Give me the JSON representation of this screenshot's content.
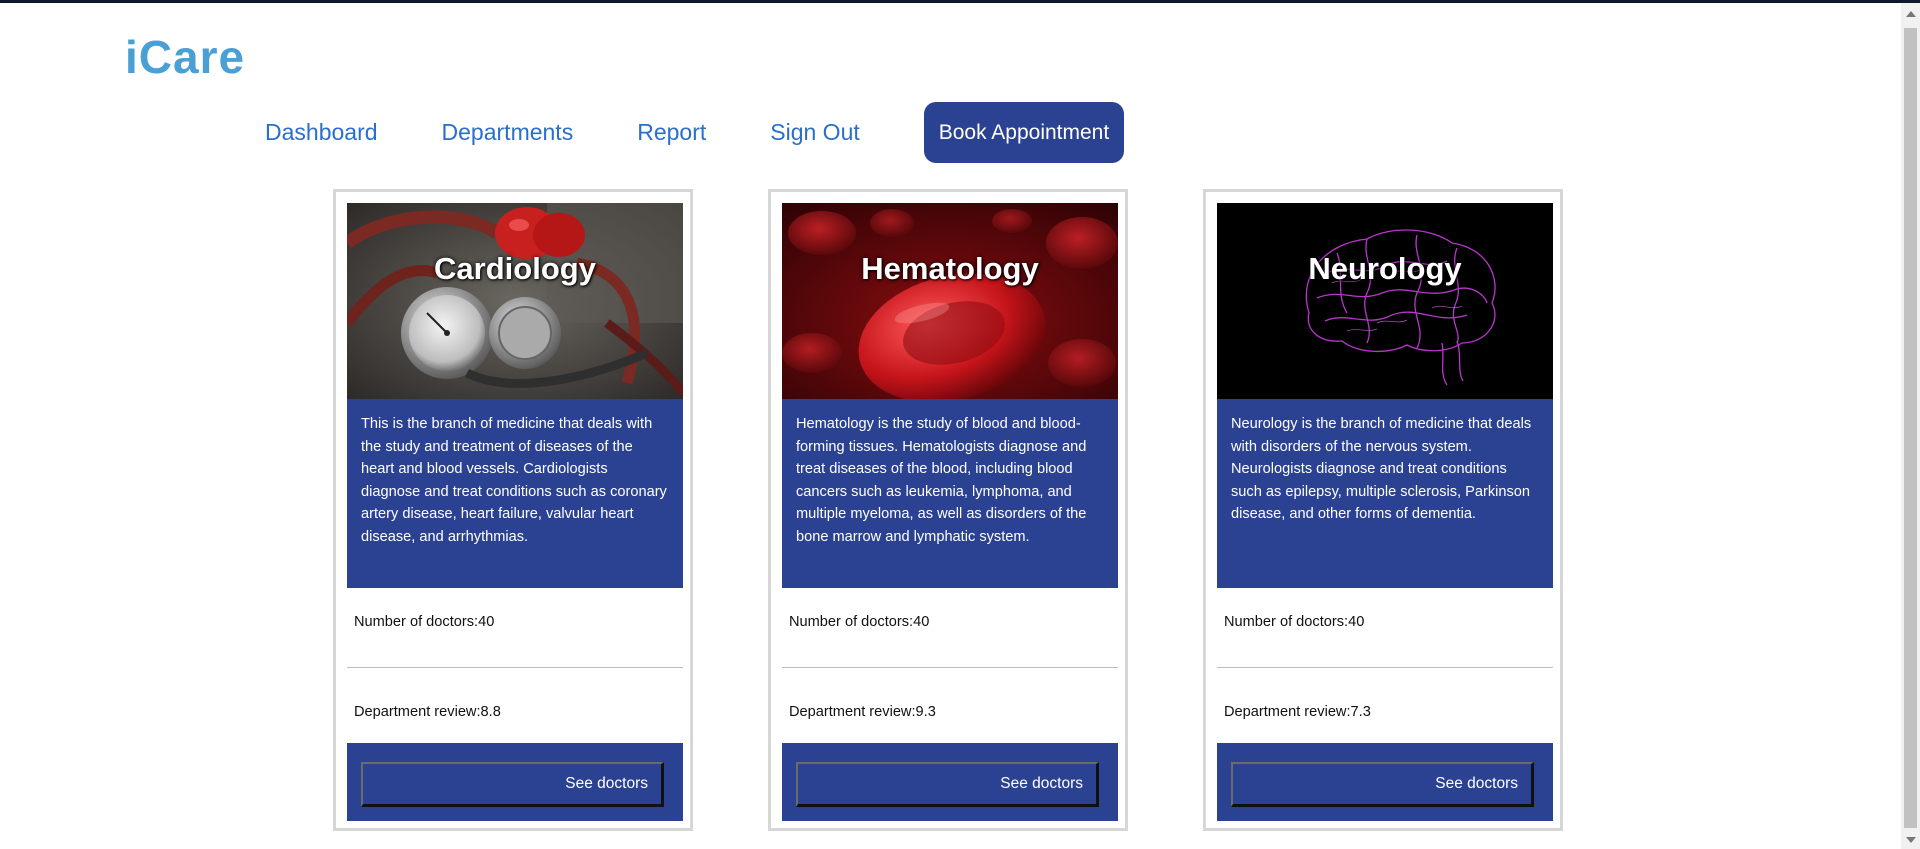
{
  "app": {
    "logo": "iCare"
  },
  "nav": {
    "links": [
      "Dashboard",
      "Departments",
      "Report",
      "Sign Out"
    ],
    "cta": "Book Appointment"
  },
  "departments": [
    {
      "title": "Cardiology",
      "description": "This is the branch of medicine that deals with the study and treatment of diseases of the heart and blood vessels. Cardiologists diagnose and treat conditions such as coronary artery disease, heart failure, valvular heart disease, and arrhythmias.",
      "doctors": "Number of doctors:40",
      "review": "Department review:8.8",
      "button": "See doctors",
      "image": "stethoscope-heart-image"
    },
    {
      "title": "Hematology",
      "description": "Hematology is the study of blood and blood-forming tissues. Hematologists diagnose and treat diseases of the blood, including blood cancers such as leukemia, lymphoma, and multiple myeloma, as well as disorders of the bone marrow and lymphatic system.",
      "doctors": "Number of doctors:40",
      "review": "Department review:9.3",
      "button": "See doctors",
      "image": "red-blood-cells-image"
    },
    {
      "title": "Neurology",
      "description": "Neurology is the branch of medicine that deals with disorders of the nervous system. Neurologists diagnose and treat conditions such as epilepsy, multiple sclerosis, Parkinson disease, and other forms of dementia.",
      "doctors": "Number of doctors:40",
      "review": "Department review:7.3",
      "button": "See doctors",
      "image": "brain-image"
    }
  ],
  "colors": {
    "brand": "#4a9fd4",
    "nav_link": "#2a6fcc",
    "primary": "#2b4192",
    "card_border": "#d6d6d6"
  }
}
